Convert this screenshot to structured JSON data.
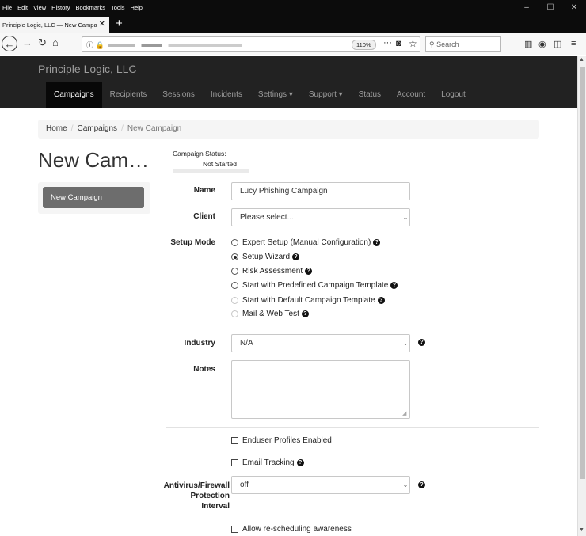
{
  "browser": {
    "menu": [
      "File",
      "Edit",
      "View",
      "History",
      "Bookmarks",
      "Tools",
      "Help"
    ],
    "tab_title": "Principle Logic, LLC — New Campa",
    "zoom": "110%",
    "search_placeholder": "Search"
  },
  "app": {
    "brand": "Principle Logic, LLC",
    "nav": [
      "Campaigns",
      "Recipients",
      "Sessions",
      "Incidents",
      "Settings ▾",
      "Support ▾",
      "Status",
      "Account",
      "Logout"
    ],
    "active_nav": "Campaigns"
  },
  "breadcrumb": [
    "Home",
    "Campaigns",
    "New Campaign"
  ],
  "page_title": "New Cam…",
  "sidebar": {
    "button": "New Campaign"
  },
  "campaign_status": {
    "label": "Campaign Status:",
    "value": "Not Started"
  },
  "form": {
    "name_label": "Name",
    "name_value": "Lucy Phishing Campaign",
    "client_label": "Client",
    "client_value": "Please select...",
    "setup_mode_label": "Setup Mode",
    "setup_modes": [
      {
        "label": "Expert Setup (Manual Configuration)",
        "help": true,
        "selected": false,
        "disabled": false
      },
      {
        "label": "Setup Wizard",
        "help": true,
        "selected": true,
        "disabled": false
      },
      {
        "label": "Risk Assessment",
        "help": true,
        "selected": false,
        "disabled": false
      },
      {
        "label": "Start with Predefined Campaign Template",
        "help": true,
        "selected": false,
        "disabled": false
      },
      {
        "label": "Start with Default Campaign Template",
        "help": true,
        "selected": false,
        "disabled": true
      },
      {
        "label": "Mail & Web Test",
        "help": true,
        "selected": false,
        "disabled": true
      }
    ],
    "industry_label": "Industry",
    "industry_value": "N/A",
    "notes_label": "Notes",
    "notes_value": "",
    "enduser_profiles_label": "Enduser Profiles Enabled",
    "email_tracking_label": "Email Tracking",
    "av_label_1": "Antivirus/Firewall",
    "av_label_2": "Protection",
    "av_label_3": "Interval",
    "av_value": "off",
    "reschedule_label": "Allow re-scheduling awareness"
  }
}
